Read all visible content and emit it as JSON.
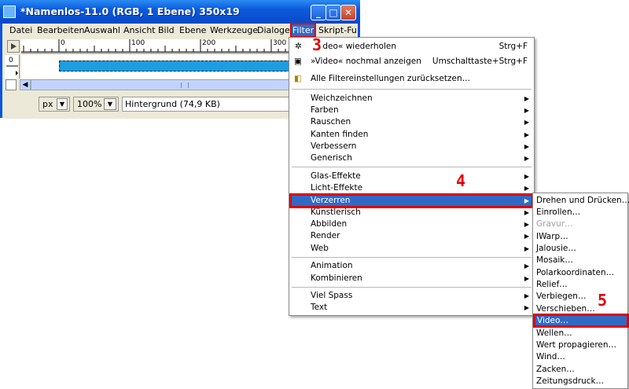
{
  "window": {
    "title": "*Namenlos-11.0 (RGB, 1 Ebene) 350x19",
    "minimize": "_",
    "maximize": "□",
    "close": "✕"
  },
  "menubar": [
    "Datei",
    "Bearbeiten",
    "Auswahl",
    "Ansicht",
    "Bild",
    "Ebene",
    "Werkzeuge",
    "Dialoge",
    "Filter",
    "Skript-Fu"
  ],
  "ruler": {
    "marks": [
      "0",
      "100",
      "200",
      "300"
    ],
    "vmark": "0"
  },
  "status": {
    "unit": "px",
    "zoom": "100%",
    "layer_info": "Hintergrund (74,9 KB)"
  },
  "filter_menu": {
    "top": [
      {
        "icon": "gear-icon",
        "label": "»Video« wiederholen",
        "shortcut": "Strg+F"
      },
      {
        "icon": "video-icon",
        "label": "»Video« nochmal anzeigen",
        "shortcut": "Umschalttaste+Strg+F"
      },
      {
        "icon": "reset-icon",
        "label": "Alle Filtereinstellungen zurücksetzen…",
        "shortcut": ""
      }
    ],
    "group1": [
      "Weichzeichnen",
      "Farben",
      "Rauschen",
      "Kanten finden",
      "Verbessern",
      "Generisch"
    ],
    "group2": [
      "Glas-Effekte",
      "Licht-Effekte",
      "Verzerren",
      "Künstlerisch",
      "Abbilden",
      "Render",
      "Web"
    ],
    "group3": [
      "Animation",
      "Kombinieren"
    ],
    "group4": [
      "Viel Spass",
      "Text"
    ]
  },
  "verzerren_menu": [
    "Drehen und Drücken…",
    "Einrollen…",
    "Gravur…",
    "IWarp…",
    "Jalousie…",
    "Mosaik…",
    "Polarkoordinaten…",
    "Relief…",
    "Verbiegen…",
    "Verschieben…",
    "Video…",
    "Wellen…",
    "Wert propagieren…",
    "Wind…",
    "Zacken…",
    "Zeitungsdruck…"
  ],
  "annotations": {
    "step3": "3",
    "step4": "4",
    "step5": "5"
  },
  "colors": {
    "highlight": "#316ac5",
    "annotation": "#e00000",
    "layer": "#1e9de0"
  }
}
